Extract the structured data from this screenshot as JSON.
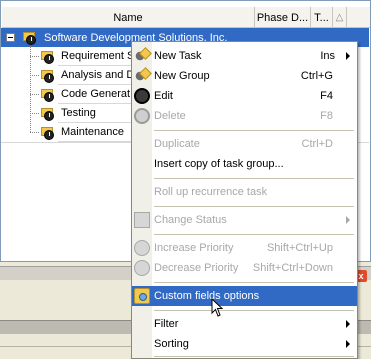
{
  "table": {
    "columns": {
      "name": "Name",
      "phase": "Phase D...",
      "t": "T...",
      "sort": "△"
    },
    "root": {
      "label": "Software Development Solutions, Inc."
    },
    "children": [
      {
        "label": "Requirement S"
      },
      {
        "label": "Analysis and D"
      },
      {
        "label": "Code Generat"
      },
      {
        "label": "Testing"
      },
      {
        "label": "Maintenance"
      }
    ]
  },
  "close_glyph": "x",
  "context_menu": {
    "items": [
      {
        "label": "New Task",
        "shortcut": "Ins",
        "submenu": true,
        "enabled": true,
        "icon": "new-task-icon"
      },
      {
        "label": "New Group",
        "shortcut": "Ctrl+G",
        "enabled": true,
        "icon": "new-group-icon"
      },
      {
        "label": "Edit",
        "shortcut": "F4",
        "enabled": true,
        "icon": "edit-icon"
      },
      {
        "label": "Delete",
        "shortcut": "F8",
        "enabled": false,
        "icon": "delete-icon"
      },
      {
        "label": "Duplicate",
        "shortcut": "Ctrl+D",
        "enabled": false
      },
      {
        "label": "Insert copy of task group...",
        "shortcut": "",
        "enabled": true
      },
      {
        "label": "Roll up recurrence task",
        "shortcut": "",
        "enabled": false
      },
      {
        "label": "Change Status",
        "shortcut": "",
        "submenu": true,
        "enabled": false,
        "icon": "change-status-icon"
      },
      {
        "label": "Increase Priority",
        "shortcut": "Shift+Ctrl+Up",
        "enabled": false,
        "icon": "increase-priority-icon"
      },
      {
        "label": "Decrease Priority",
        "shortcut": "Shift+Ctrl+Down",
        "enabled": false,
        "icon": "decrease-priority-icon"
      },
      {
        "label": "Custom fields options",
        "shortcut": "",
        "enabled": true,
        "selected": true,
        "icon": "custom-fields-icon"
      },
      {
        "label": "Filter",
        "shortcut": "",
        "submenu": true,
        "enabled": true
      },
      {
        "label": "Sorting",
        "shortcut": "",
        "submenu": true,
        "enabled": true
      }
    ]
  },
  "colors": {
    "selection": "#316ac5",
    "disabled_text": "#a8a8a8",
    "menu_background": "#ffffff"
  }
}
